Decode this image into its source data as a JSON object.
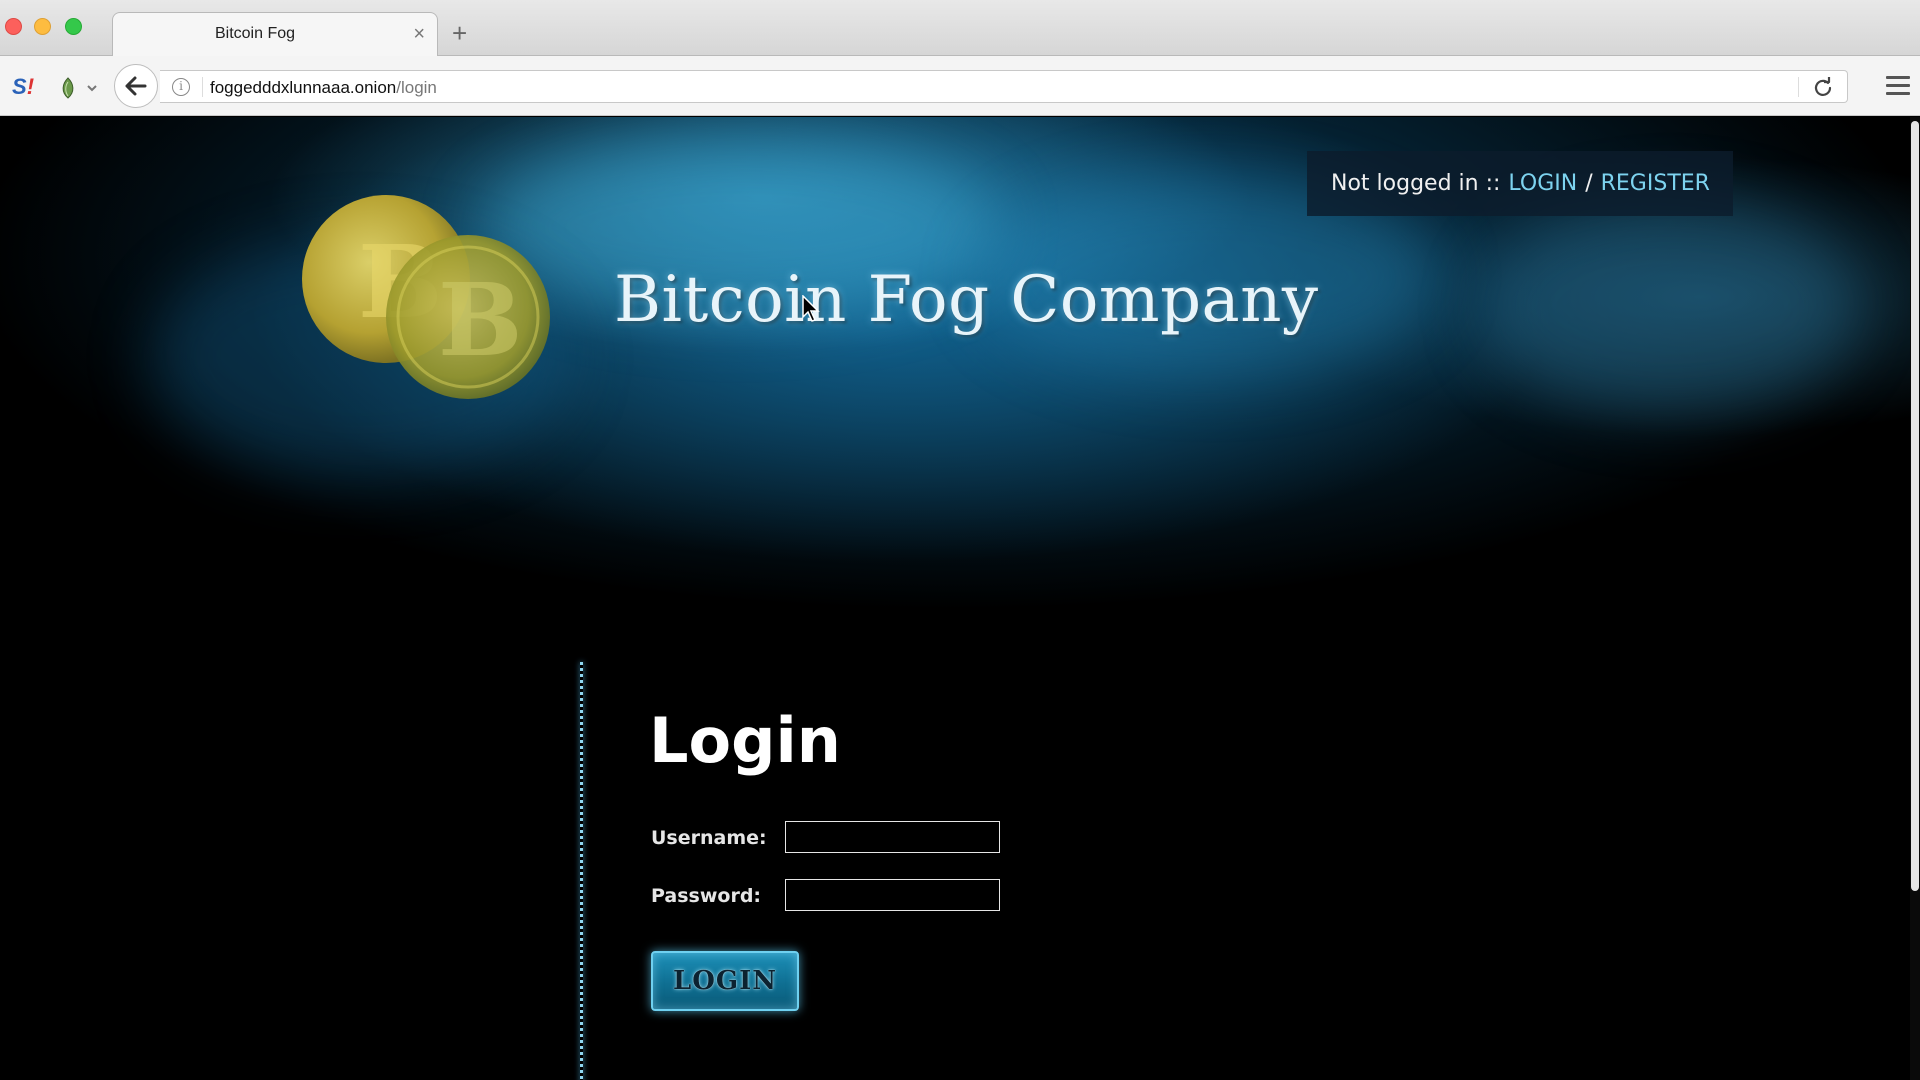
{
  "browser": {
    "tab_title": "Bitcoin Fog",
    "tab_close": "×",
    "new_tab": "+",
    "url_host": "foggedddxlunnaaa.onion",
    "url_path": "/login"
  },
  "extensions": {
    "s_badge_letter": "S",
    "s_badge_mark": "!"
  },
  "header": {
    "site_title": "Bitcoin Fog Company",
    "auth_status": "Not logged in ::",
    "login_link": "LOGIN",
    "separator": "/",
    "register_link": "REGISTER"
  },
  "login_form": {
    "heading": "Login",
    "username_label": "Username:",
    "password_label": "Password:",
    "username_value": "",
    "password_value": "",
    "submit_label": "LOGIN"
  },
  "colors": {
    "accent_link": "#7dd3ef",
    "button_glow": "#6fd0f0",
    "coin_gold": "#c9b13a"
  }
}
